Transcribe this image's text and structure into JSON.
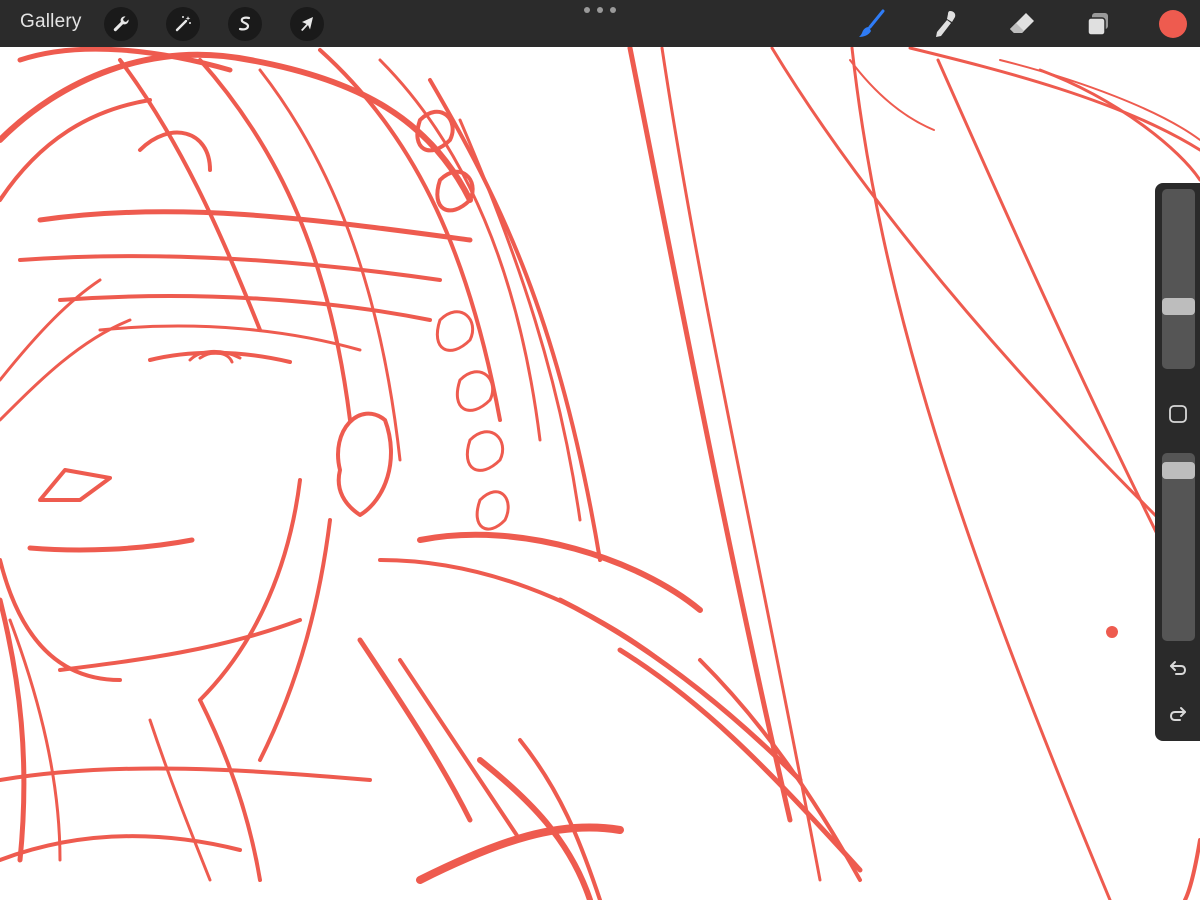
{
  "topbar": {
    "gallery_label": "Gallery",
    "actions_icon": "wrench-icon",
    "adjustments_icon": "magic-wand-icon",
    "selection_icon": "selection-s-icon",
    "transform_icon": "arrow-cursor-icon",
    "brush_icon": "brush-icon",
    "smudge_icon": "smudge-finger-icon",
    "eraser_icon": "eraser-icon",
    "layers_icon": "layers-icon"
  },
  "colors": {
    "toolbar_bg": "#2b2b2b",
    "active_tool": "#2f7cf6",
    "current_color": "#ee5b4f",
    "stroke": "#ee5b4f",
    "canvas_bg": "#ffffff"
  },
  "sidebar": {
    "brush_size_level": 0.33,
    "opacity_level": 0.95,
    "undo_icon": "undo-icon",
    "redo_icon": "redo-icon",
    "modify_icon": "square-modify-icon"
  }
}
